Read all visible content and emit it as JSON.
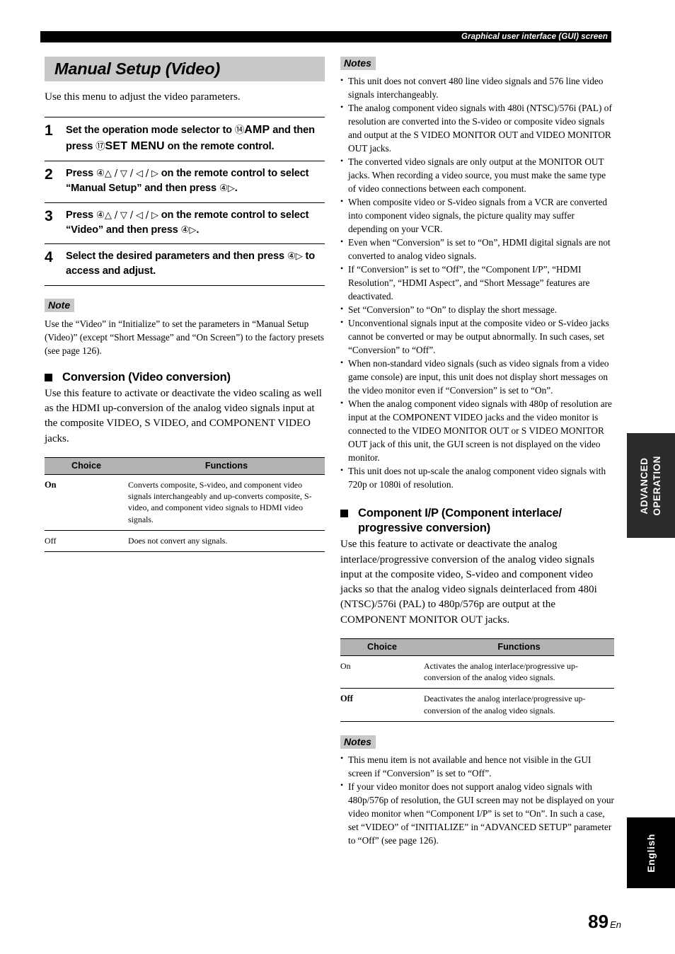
{
  "header": {
    "running_title": "Graphical user interface (GUI) screen"
  },
  "title": "Manual Setup (Video)",
  "intro": "Use this menu to adjust the video parameters.",
  "steps": [
    {
      "number": "1",
      "text_parts": [
        {
          "t": "Set the operation mode selector to ",
          "style": "normal"
        },
        {
          "t": "⑭",
          "style": "circled"
        },
        {
          "t": "AMP",
          "style": "key"
        },
        {
          "t": " and then press ",
          "style": "normal"
        },
        {
          "t": "⑰",
          "style": "circled"
        },
        {
          "t": "SET MENU",
          "style": "key"
        },
        {
          "t": " on the remote control.",
          "style": "normal"
        }
      ],
      "plain": "Set the operation mode selector to ⑭ AMP and then press ⑰ SET MENU on the remote control."
    },
    {
      "number": "2",
      "text_parts": [
        {
          "t": "Press ",
          "style": "normal"
        },
        {
          "t": "④",
          "style": "circled"
        },
        {
          "t": "△ / ▽ / ◁ / ▷",
          "style": "arrow"
        },
        {
          "t": " on the remote control to select “Manual Setup” and then press ",
          "style": "normal"
        },
        {
          "t": "④",
          "style": "circled"
        },
        {
          "t": "▷",
          "style": "arrow"
        },
        {
          "t": ".",
          "style": "normal"
        }
      ],
      "plain": "Press ④△ / ▽ / ◁ / ▷ on the remote control to select “Manual Setup” and then press ④▷."
    },
    {
      "number": "3",
      "text_parts": [
        {
          "t": "Press ",
          "style": "normal"
        },
        {
          "t": "④",
          "style": "circled"
        },
        {
          "t": "△ / ▽ / ◁ / ▷",
          "style": "arrow"
        },
        {
          "t": " on the remote control to select “Video” and then press ",
          "style": "normal"
        },
        {
          "t": "④",
          "style": "circled"
        },
        {
          "t": "▷",
          "style": "arrow"
        },
        {
          "t": ".",
          "style": "normal"
        }
      ],
      "plain": "Press ④△ / ▽ / ◁ / ▷ on the remote control to select “Video” and then press ④▷."
    },
    {
      "number": "4",
      "text_parts": [
        {
          "t": "Select the desired parameters and then press ",
          "style": "normal"
        },
        {
          "t": "④",
          "style": "circled"
        },
        {
          "t": "▷",
          "style": "arrow"
        },
        {
          "t": " to access and adjust.",
          "style": "normal"
        }
      ],
      "plain": "Select the desired parameters and then press ④▷ to access and adjust."
    }
  ],
  "left_note": {
    "label": "Note",
    "body": "Use the “Video” in “Initialize” to set the parameters in “Manual Setup (Video)” (except “Short Message” and “On Screen”) to the factory presets (see page 126)."
  },
  "conversion_section": {
    "heading": "Conversion (Video conversion)",
    "body": "Use this feature to activate or deactivate the video scaling as well as the HDMI up-conversion of the analog video signals input at the composite VIDEO, S VIDEO, and COMPONENT VIDEO jacks.",
    "table": {
      "headers": [
        "Choice",
        "Functions"
      ],
      "rows": [
        {
          "choice": "On",
          "choice_bold": true,
          "function": "Converts composite, S-video, and component video signals interchangeably and up-converts composite, S-video, and component video signals to HDMI video signals."
        },
        {
          "choice": "Off",
          "choice_bold": false,
          "function": "Does not convert any signals."
        }
      ]
    }
  },
  "right_notes_top": {
    "label": "Notes",
    "items": [
      "This unit does not convert 480 line video signals and 576 line video signals interchangeably.",
      "The analog component video signals with 480i (NTSC)/576i (PAL) of resolution are converted into the S-video or composite video signals and output at the S VIDEO MONITOR OUT and VIDEO MONITOR OUT jacks.",
      "The converted video signals are only output at the MONITOR OUT jacks. When recording a video source, you must make the same type of video connections between each component.",
      "When composite video or S-video signals from a VCR are converted into component video signals, the picture quality may suffer depending on your VCR.",
      "Even when “Conversion” is set to “On”, HDMI digital signals are not converted to analog video signals.",
      "If “Conversion” is set to “Off”, the “Component I/P”, “HDMI Resolution”, “HDMI Aspect”, and “Short Message” features are deactivated.",
      "Set “Conversion” to “On” to display the short message.",
      "Unconventional signals input at the composite video or S-video jacks cannot be converted or may be output abnormally. In such cases, set “Conversion” to “Off”.",
      "When non-standard video signals (such as video signals from a video game console) are input, this unit does not display short messages on the video monitor even if “Conversion” is set to “On”.",
      "When the analog component video signals with 480p of resolution are input at the COMPONENT VIDEO jacks and the video monitor is connected to the VIDEO MONITOR OUT or S VIDEO MONITOR OUT jack of this unit, the GUI screen is not displayed on the video monitor.",
      "This unit does not up-scale the analog component video signals with 720p or 1080i of resolution."
    ]
  },
  "component_section": {
    "heading": "Component I/P (Component interlace/ progressive conversion)",
    "body": "Use this feature to activate or deactivate the analog interlace/progressive conversion of the analog video signals input at the composite video, S-video and component video jacks so that the analog video signals deinterlaced from 480i (NTSC)/576i (PAL) to 480p/576p are output at the COMPONENT MONITOR OUT jacks.",
    "table": {
      "headers": [
        "Choice",
        "Functions"
      ],
      "rows": [
        {
          "choice": "On",
          "choice_bold": false,
          "function": "Activates the analog interlace/progressive up-conversion of the analog video signals."
        },
        {
          "choice": "Off",
          "choice_bold": true,
          "function": "Deactivates the analog interlace/progressive up-conversion of the analog video signals."
        }
      ]
    }
  },
  "right_notes_bottom": {
    "label": "Notes",
    "items": [
      "This menu item is not available and hence not visible in the GUI screen if “Conversion” is set to “Off”.",
      "If your video monitor does not support analog video signals with 480p/576p of resolution, the GUI screen may not be displayed on your video monitor when “Component I/P” is set to “On”. In such a case, set “VIDEO” of “INITIALIZE” in “ADVANCED SETUP” parameter to “Off” (see page 126)."
    ]
  },
  "side_tabs": [
    {
      "label": "ADVANCED\nOPERATION",
      "line1": "ADVANCED",
      "line2": "OPERATION"
    },
    {
      "label": "English"
    }
  ],
  "footer": {
    "page_number": "89",
    "language_mark": "En"
  },
  "colors": {
    "title_band": "#c8c8c8",
    "table_header": "#b3b3b3",
    "tab_advanced": "#2b2b2b",
    "tab_english": "#000000",
    "header_bar": "#000000"
  }
}
